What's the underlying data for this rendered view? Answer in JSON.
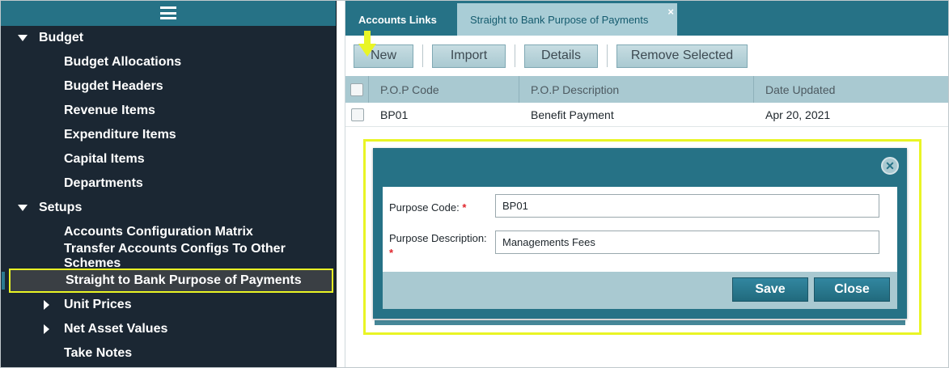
{
  "sidebar": {
    "items": [
      {
        "label": "Budget",
        "type": "group"
      },
      {
        "label": "Budget Allocations",
        "type": "sub"
      },
      {
        "label": "Bugdet Headers",
        "type": "sub"
      },
      {
        "label": "Revenue Items",
        "type": "sub"
      },
      {
        "label": "Expenditure Items",
        "type": "sub"
      },
      {
        "label": "Capital Items",
        "type": "sub"
      },
      {
        "label": "Departments",
        "type": "sub"
      },
      {
        "label": "Setups",
        "type": "group"
      },
      {
        "label": "Accounts Configuration Matrix",
        "type": "sub"
      },
      {
        "label": "Transfer Accounts Configs To Other Schemes",
        "type": "sub"
      },
      {
        "label": "Straight to Bank Purpose of Payments",
        "type": "sub",
        "active": true
      },
      {
        "label": "Unit Prices",
        "type": "sub",
        "expandable": true
      },
      {
        "label": "Net Asset Values",
        "type": "sub",
        "expandable": true
      },
      {
        "label": "Take Notes",
        "type": "sub"
      }
    ]
  },
  "tabs": [
    {
      "label": "Accounts Links",
      "active": false
    },
    {
      "label": "Straight to Bank Purpose of Payments",
      "active": true,
      "close": "×"
    }
  ],
  "toolbar": {
    "new_label": "New",
    "import_label": "Import",
    "details_label": "Details",
    "remove_label": "Remove Selected"
  },
  "grid": {
    "columns": [
      "P.O.P Code",
      "P.O.P Description",
      "Date Updated"
    ],
    "rows": [
      {
        "code": "BP01",
        "description": "Benefit Payment",
        "date": "Apr 20, 2021"
      }
    ]
  },
  "modal": {
    "close_glyph": "✕",
    "purpose_code_label": "Purpose Code:",
    "purpose_code_value": "BP01",
    "purpose_description_label": "Purpose Description:",
    "purpose_description_value": "Managements Fees",
    "required_marker": "*",
    "save_label": "Save",
    "close_label": "Close"
  },
  "colors": {
    "teal": "#267286",
    "light_teal": "#a9c9d1",
    "sidebar_bg": "#1b2733",
    "highlight": "#e9f525"
  }
}
